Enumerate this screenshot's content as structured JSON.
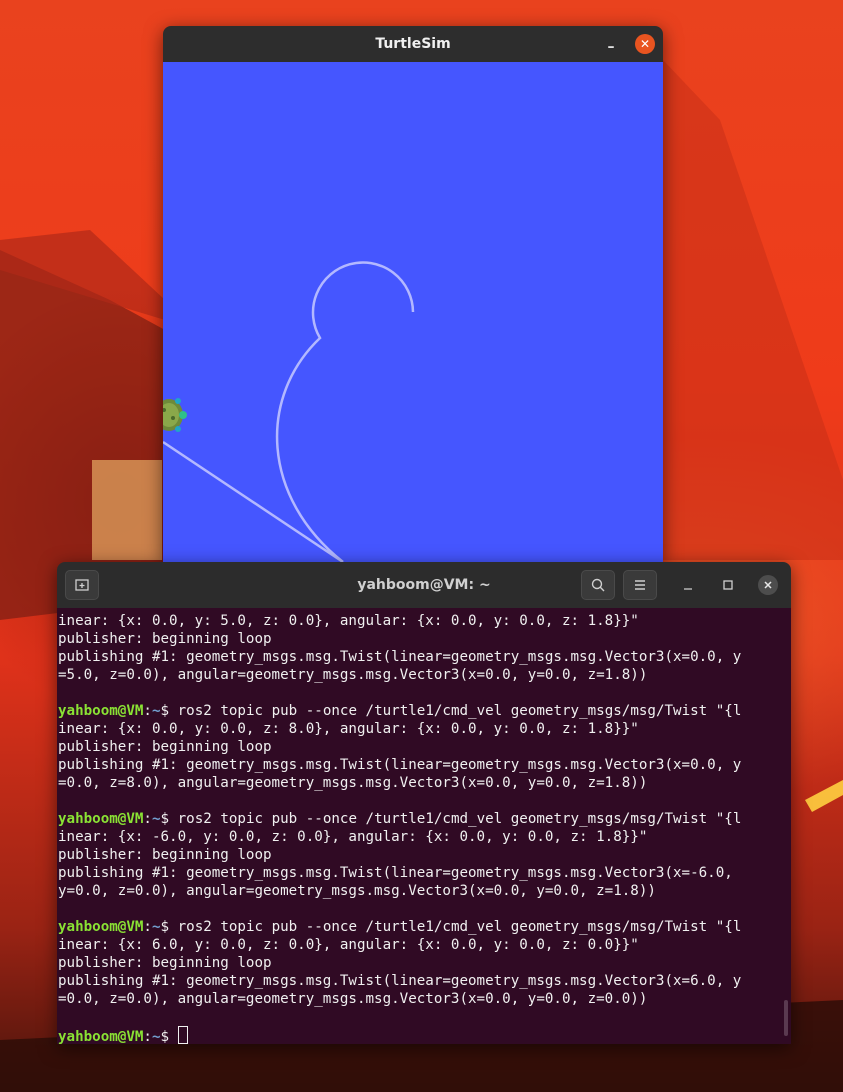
{
  "turtlesim": {
    "title": "TurtleSim",
    "minimize_glyph": "–",
    "close_glyph": "✕",
    "canvas_color": "#4556ff",
    "pen_color": "#b3b8ff"
  },
  "terminal": {
    "title": "yahboom@VM: ~",
    "new_tab_icon": "new-tab-icon",
    "prompt_user": "yahboom@VM",
    "prompt_sep": ":",
    "prompt_path": "~",
    "prompt_dollar": "$ ",
    "lines": [
      {
        "text": "inear: {x: 0.0, y: 5.0, z: 0.0}, angular: {x: 0.0, y: 0.0, z: 1.8}}\""
      },
      {
        "text": "publisher: beginning loop"
      },
      {
        "text": "publishing #1: geometry_msgs.msg.Twist(linear=geometry_msgs.msg.Vector3(x=0.0, y"
      },
      {
        "text": "=5.0, z=0.0), angular=geometry_msgs.msg.Vector3(x=0.0, y=0.0, z=1.8))"
      },
      {
        "text": ""
      },
      {
        "prompt": true,
        "text": "ros2 topic pub --once /turtle1/cmd_vel geometry_msgs/msg/Twist \"{l"
      },
      {
        "text": "inear: {x: 0.0, y: 0.0, z: 8.0}, angular: {x: 0.0, y: 0.0, z: 1.8}}\""
      },
      {
        "text": "publisher: beginning loop"
      },
      {
        "text": "publishing #1: geometry_msgs.msg.Twist(linear=geometry_msgs.msg.Vector3(x=0.0, y"
      },
      {
        "text": "=0.0, z=8.0), angular=geometry_msgs.msg.Vector3(x=0.0, y=0.0, z=1.8))"
      },
      {
        "text": ""
      },
      {
        "prompt": true,
        "text": "ros2 topic pub --once /turtle1/cmd_vel geometry_msgs/msg/Twist \"{l"
      },
      {
        "text": "inear: {x: -6.0, y: 0.0, z: 0.0}, angular: {x: 0.0, y: 0.0, z: 1.8}}\""
      },
      {
        "text": "publisher: beginning loop"
      },
      {
        "text": "publishing #1: geometry_msgs.msg.Twist(linear=geometry_msgs.msg.Vector3(x=-6.0,"
      },
      {
        "text": "y=0.0, z=0.0), angular=geometry_msgs.msg.Vector3(x=0.0, y=0.0, z=1.8))"
      },
      {
        "text": ""
      },
      {
        "prompt": true,
        "text": "ros2 topic pub --once /turtle1/cmd_vel geometry_msgs/msg/Twist \"{l"
      },
      {
        "text": "inear: {x: 6.0, y: 0.0, z: 0.0}, angular: {x: 0.0, y: 0.0, z: 0.0}}\""
      },
      {
        "text": "publisher: beginning loop"
      },
      {
        "text": "publishing #1: geometry_msgs.msg.Twist(linear=geometry_msgs.msg.Vector3(x=6.0, y"
      },
      {
        "text": "=0.0, z=0.0), angular=geometry_msgs.msg.Vector3(x=0.0, y=0.0, z=0.0))"
      },
      {
        "text": ""
      },
      {
        "prompt": true,
        "text": "",
        "cursor": true
      }
    ]
  }
}
